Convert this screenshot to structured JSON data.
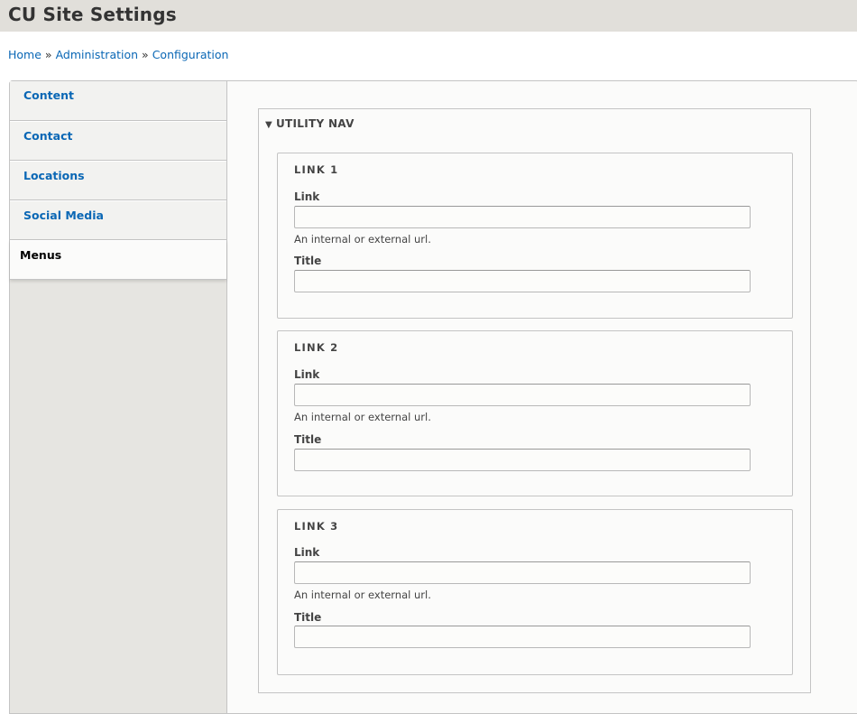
{
  "header": {
    "title": "CU Site Settings"
  },
  "breadcrumb": {
    "items": [
      "Home",
      "Administration",
      "Configuration"
    ],
    "separator": "»"
  },
  "tabs": [
    {
      "label": "Content",
      "selected": false
    },
    {
      "label": "Contact",
      "selected": false
    },
    {
      "label": "Locations",
      "selected": false
    },
    {
      "label": "Social Media",
      "selected": false
    },
    {
      "label": "Menus",
      "selected": true
    }
  ],
  "fieldset": {
    "legend": "UTILITY NAV",
    "toggle_icon": "triangle-down-icon",
    "links": [
      {
        "title": "LINK 1",
        "link_label": "Link",
        "link_value": "",
        "link_description": "An internal or external url.",
        "title_label": "Title",
        "title_value": ""
      },
      {
        "title": "LINK 2",
        "link_label": "Link",
        "link_value": "",
        "link_description": "An internal or external url.",
        "title_label": "Title",
        "title_value": ""
      },
      {
        "title": "LINK 3",
        "link_label": "Link",
        "link_value": "",
        "link_description": "An internal or external url.",
        "title_label": "Title",
        "title_value": ""
      }
    ]
  },
  "colors": {
    "link": "#0a67b5",
    "header_bg": "#e1dfda",
    "tab_bg": "#f2f2f0",
    "sidebar_bg": "#e6e5e1",
    "border": "#c4c4c4"
  }
}
